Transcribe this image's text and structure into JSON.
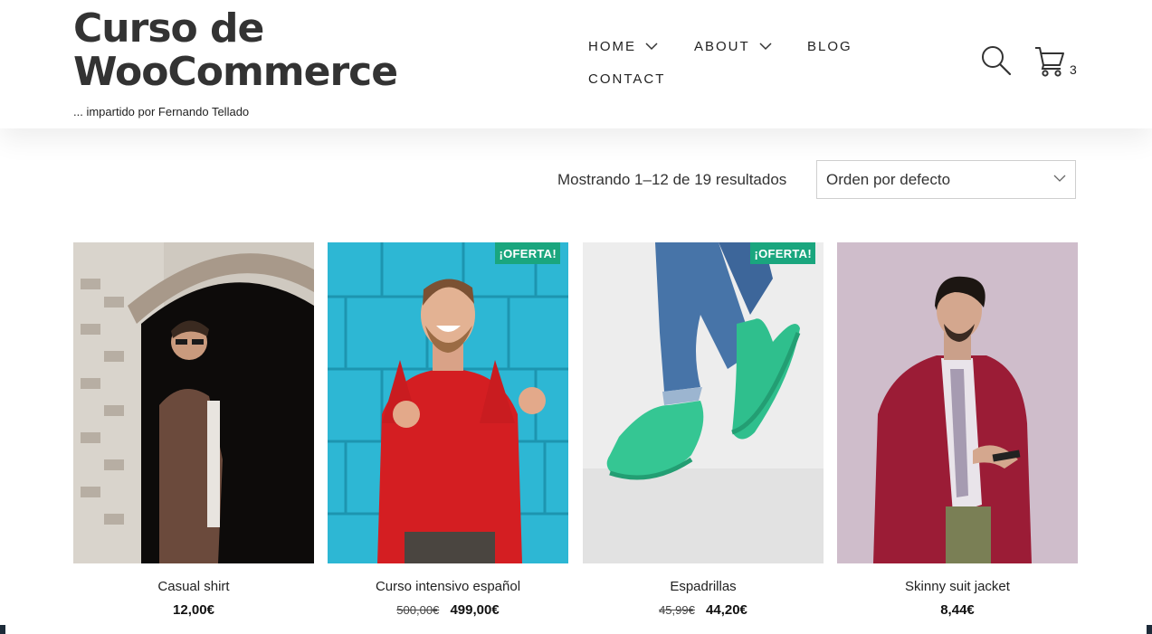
{
  "site": {
    "title": "Curso de WooCommerce",
    "tagline": "... impartido por Fernando Tellado"
  },
  "nav": {
    "items": [
      {
        "label": "HOME",
        "has_dropdown": true
      },
      {
        "label": "ABOUT",
        "has_dropdown": true
      },
      {
        "label": "BLOG",
        "has_dropdown": false
      },
      {
        "label": "CONTACT",
        "has_dropdown": false
      }
    ]
  },
  "header_icons": {
    "search_icon": "search-icon",
    "cart_icon": "cart-icon",
    "cart_count": "3"
  },
  "shop": {
    "result_count": "Mostrando 1–12 de 19 resultados",
    "sort_selected": "Orden por defecto"
  },
  "products": [
    {
      "name": "Casual shirt",
      "price": "12,00€",
      "old_price": null,
      "badge": null
    },
    {
      "name": "Curso intensivo español",
      "price": "499,00€",
      "old_price": "500,00€",
      "badge": "¡OFERTA!"
    },
    {
      "name": "Espadrillas",
      "price": "44,20€",
      "old_price": "45,99€",
      "badge": "¡OFERTA!"
    },
    {
      "name": "Skinny suit jacket",
      "price": "8,44€",
      "old_price": null,
      "badge": null
    }
  ],
  "colors": {
    "sale_badge": "#1aa67e",
    "text": "#222222"
  }
}
